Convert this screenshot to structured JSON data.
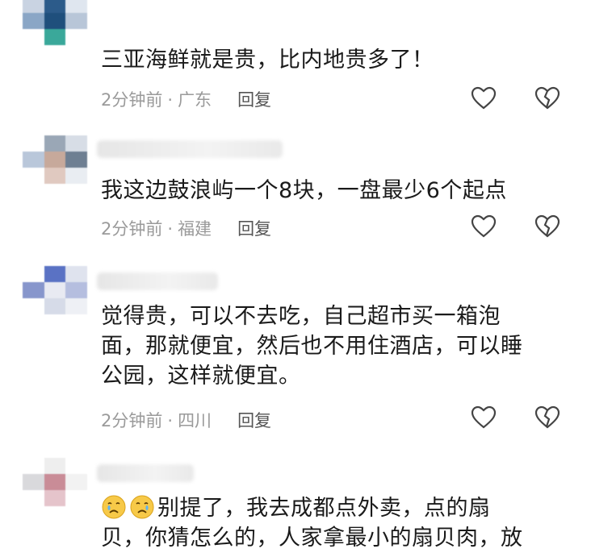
{
  "comments": [
    {
      "text": "三亚海鲜就是贵，比内地贵多了！",
      "time": "2分钟前",
      "separator": "·",
      "location": "广东",
      "reply": "回复"
    },
    {
      "text": "我这边鼓浪屿一个8块，一盘最少6个起点",
      "time": "2分钟前",
      "separator": "·",
      "location": "福建",
      "reply": "回复"
    },
    {
      "text": "觉得贵，可以不去吃，自己超市买一箱泡\n面，那就便宜，然后也不用住酒店，可以睡\n公园，这样就便宜。",
      "time": "2分钟前",
      "separator": "·",
      "location": "四川",
      "reply": "回复"
    },
    {
      "text": "别提了，我去成都点外卖，点的扇\n贝，你猜怎么的，人家拿最小的扇贝肉，放"
    }
  ],
  "colors": {
    "text": "#1a1a1a",
    "meta": "#9a9a9a",
    "reply": "#555555",
    "icon_stroke": "#444444"
  },
  "icons": [
    "heart-outline-icon",
    "broken-heart-icon",
    "crying-face-emoji"
  ]
}
